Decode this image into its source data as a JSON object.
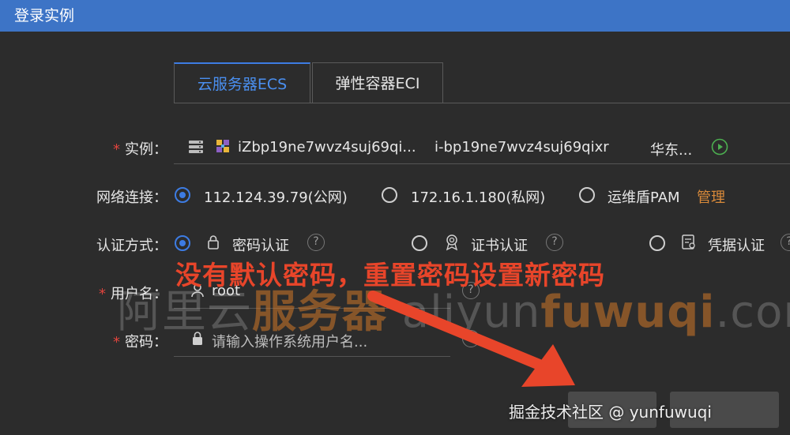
{
  "window": {
    "title": "登录实例"
  },
  "tabs": [
    {
      "label": "云服务器ECS",
      "active": true
    },
    {
      "label": "弹性容器ECI",
      "active": false
    }
  ],
  "instance": {
    "label": "实例：",
    "name": "iZbp19ne7wvz4suj69qi...",
    "id": "i-bp19ne7wvz4suj69qixr",
    "region": "华东..."
  },
  "network": {
    "label": "网络连接：",
    "options": [
      {
        "label": "112.124.39.79(公网)",
        "selected": true
      },
      {
        "label": "172.16.1.180(私网)",
        "selected": false
      },
      {
        "label": "运维盾PAM",
        "selected": false
      }
    ],
    "manage_link": "管理"
  },
  "auth": {
    "label": "认证方式：",
    "options": [
      {
        "label": "密码认证",
        "selected": true
      },
      {
        "label": "证书认证",
        "selected": false
      },
      {
        "label": "凭据认证",
        "selected": false
      }
    ]
  },
  "username": {
    "label": "用户名：",
    "value": "root"
  },
  "password": {
    "label": "密码：",
    "placeholder": "请输入操作系统用户名..."
  },
  "overlay": {
    "annotation": "没有默认密码，重置密码设置新密码",
    "watermark_part1": "阿里云",
    "watermark_part2": "服务器",
    "watermark_part3": " aliyun",
    "watermark_part4": "fuwuqi",
    "watermark_part5": ".com",
    "credit": "掘金技术社区 @ yunfuwuqi"
  },
  "colors": {
    "titlebar": "#3d74c6",
    "accent": "#3d7ce3",
    "manage_link": "#d98a3a",
    "annotation": "#e8452a",
    "required": "#e0443d",
    "run_icon": "#4caf50"
  }
}
